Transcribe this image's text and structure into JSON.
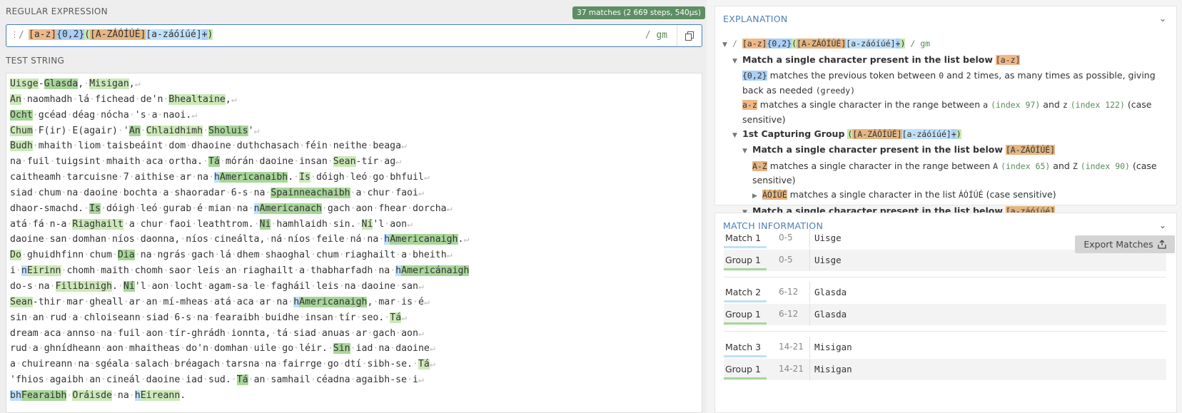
{
  "regex_section": {
    "title": "REGULAR EXPRESSION",
    "badge": "37 matches (2 669 steps, 540µs)",
    "delimiter": "/",
    "expression_parts": [
      "[a-z]",
      "{0,2}",
      "(",
      "[A-ZÁÓÍÚÉ]",
      "[a-záóíúé]",
      "+",
      ")"
    ],
    "flags_prefix": "/",
    "flags": "gm"
  },
  "test_section": {
    "title": "TEST STRING"
  },
  "explanation": {
    "title": "EXPLANATION",
    "root_regex_parts": [
      "[a-z]",
      "{0,2}",
      "(",
      "[A-ZÁÓÍÚÉ]",
      "[a-záóíúé]",
      "+",
      ")"
    ],
    "root_suffix": "/ gm",
    "item1_title": "Match a single character present in the list below",
    "item1_token": "[a-z]",
    "quant_token": "{0,2}",
    "quant_text_1": "matches the previous token between",
    "quant_n1": "0",
    "quant_text_2": "and",
    "quant_n2": "2",
    "quant_text_3": "times, as many times as possible, giving back as needed",
    "quant_greedy": "(greedy)",
    "range1_token": "a-z",
    "range1_text": "matches a single character in the range between",
    "range1_a": "a",
    "range1_a_idx": "(index 97)",
    "range1_and": "and",
    "range1_z": "z",
    "range1_z_idx": "(index 122)",
    "range1_tail": "(case sensitive)",
    "group_title": "1st Capturing Group",
    "group_parts": [
      "(",
      "[A-ZÁÓÍÚÉ]",
      "[a-záóíúé]",
      "+",
      ")"
    ],
    "item2_title": "Match a single character present in the list below",
    "item2_token": "[A-ZÁÓÍÚÉ]",
    "range2_token": "A-Z",
    "range2_text": "matches a single character in the range between",
    "range2_a": "A",
    "range2_a_idx": "(index 65)",
    "range2_and": "and",
    "range2_z": "Z",
    "range2_z_idx": "(index 90)",
    "range2_tail": "(case sensitive)",
    "list_token": "ÁÓÍÚÉ",
    "list_text": "matches a single character in the list",
    "list_chars": "ÁÓÍÚÉ",
    "list_tail": "(case sensitive)",
    "item3_title": "Match a single character present in the list below",
    "item3_token": "[a-záóíúé]"
  },
  "match_info": {
    "title": "MATCH INFORMATION",
    "export_label": "Export Matches",
    "rows": [
      {
        "label": "Match 1",
        "range": "0-5",
        "value": "Uisge",
        "kind": "match"
      },
      {
        "label": "Group 1",
        "range": "0-5",
        "value": "Uisge",
        "kind": "group"
      },
      {
        "label": "Match 2",
        "range": "6-12",
        "value": "Glasda",
        "kind": "match"
      },
      {
        "label": "Group 1",
        "range": "6-12",
        "value": "Glasda",
        "kind": "group"
      },
      {
        "label": "Match 3",
        "range": "14-21",
        "value": "Misigan",
        "kind": "match"
      },
      {
        "label": "Group 1",
        "range": "14-21",
        "value": "Misigan",
        "kind": "group"
      }
    ]
  },
  "colors": {
    "accent": "#4a7fb7",
    "badge": "#5e8e63",
    "match_light": "#cce9b8",
    "match_dark": "#a8d69a",
    "match_blue": "#bfe0f8"
  },
  "test_lines": [
    [
      {
        "t": "Uisge",
        "c": "m"
      },
      {
        "t": "-"
      },
      {
        "t": "Glasda",
        "c": "m2"
      },
      {
        "t": ",·"
      },
      {
        "t": "Misigan",
        "c": "m"
      },
      {
        "t": ",↵"
      }
    ],
    [
      {
        "t": "An",
        "c": "m"
      },
      {
        "t": "·naomhadh·lá·fichead·de'n·"
      },
      {
        "t": "Bhealtaine",
        "c": "m"
      },
      {
        "t": ",↵"
      }
    ],
    [
      {
        "t": "Ocht",
        "c": "m2"
      },
      {
        "t": "·gcéad·déag·nócha·'s·a·naoi.↵"
      }
    ],
    [
      {
        "t": "Chum",
        "c": "m"
      },
      {
        "t": "·F(ir)·E(agair)·'"
      },
      {
        "t": "An",
        "c": "m2"
      },
      {
        "t": "·"
      },
      {
        "t": "Chlaidhimh",
        "c": "m"
      },
      {
        "t": "·"
      },
      {
        "t": "Sholuis",
        "c": "m2"
      },
      {
        "t": "'↵"
      }
    ],
    [
      {
        "t": "Budh",
        "c": "m"
      },
      {
        "t": "·mhaith·liom·taisbeáint·dom·dhaoine·duthchasach·féin·neithe·beaga↵"
      }
    ],
    [
      {
        "t": "na·fuil·tuigsint·mhaith·aca·ortha.·"
      },
      {
        "t": "Tá",
        "c": "m2"
      },
      {
        "t": "·mórán·daoine·insan·"
      },
      {
        "t": "Sean",
        "c": "m"
      },
      {
        "t": "-tír·ag↵"
      }
    ],
    [
      {
        "t": "caitheamh·tarcuisne·7·aithise·ar·na·"
      },
      {
        "t": "h",
        "c": "mh"
      },
      {
        "t": "Americanaibh",
        "c": "m2"
      },
      {
        "t": ".·"
      },
      {
        "t": "Is",
        "c": "m"
      },
      {
        "t": "·dóigh·leó·go·bhfuil↵"
      }
    ],
    [
      {
        "t": "siad·chum·na·daoine·bochta·a·shaoradar·6-s·na·"
      },
      {
        "t": "Spainneachaibh",
        "c": "m2"
      },
      {
        "t": "·a·chur·faoi↵"
      }
    ],
    [
      {
        "t": "dhaor-smachd.·"
      },
      {
        "t": "Is",
        "c": "m2"
      },
      {
        "t": "·dóigh·leó·gurab·é·mian·na·"
      },
      {
        "t": "n",
        "c": "mh"
      },
      {
        "t": "Americanach",
        "c": "m2"
      },
      {
        "t": "·gach·aon·fhear·dorcha↵"
      }
    ],
    [
      {
        "t": "atá·fá·n-a·"
      },
      {
        "t": "Riaghailt",
        "c": "m"
      },
      {
        "t": "·a·chur·faoi·leathtrom.·"
      },
      {
        "t": "Ni",
        "c": "m2"
      },
      {
        "t": "·hamhlaidh·sin.·"
      },
      {
        "t": "Ní",
        "c": "m"
      },
      {
        "t": "'l·aon↵"
      }
    ],
    [
      {
        "t": "daoine·san·domhan·níos·daonna,·níos·cineálta,·ná·níos·feile·ná·na·"
      },
      {
        "t": "h",
        "c": "mh"
      },
      {
        "t": "Americanaigh",
        "c": "m2"
      },
      {
        "t": ".↵"
      }
    ],
    [
      {
        "t": "Do",
        "c": "m"
      },
      {
        "t": "·ghuidhfinn·chum·"
      },
      {
        "t": "Dia",
        "c": "m2"
      },
      {
        "t": "·na·ngrás·gach·lá·dhem·shaoghal·chum·riaghailt·a·bheith↵"
      }
    ],
    [
      {
        "t": "i·"
      },
      {
        "t": "n",
        "c": "mh"
      },
      {
        "t": "Eirinn",
        "c": "m"
      },
      {
        "t": "·chomh·maith·chomh·saor·leis·an·riaghailt·a·thabharfadh·na·"
      },
      {
        "t": "h",
        "c": "mh"
      },
      {
        "t": "Americánaigh",
        "c": "m2"
      },
      {
        "t": ""
      }
    ],
    [
      {
        "t": "do-s·na·"
      },
      {
        "t": "Filibinigh",
        "c": "m"
      },
      {
        "t": ".·"
      },
      {
        "t": "Ní",
        "c": "m2"
      },
      {
        "t": "'l·aon·locht·agam-sa·le·fagháil·leis·na·daoine·san↵"
      }
    ],
    [
      {
        "t": "Sean",
        "c": "m"
      },
      {
        "t": "-thir·mar·gheall·ar·an·mí-mheas·atá·aca·ar·na·"
      },
      {
        "t": "h",
        "c": "mh"
      },
      {
        "t": "Americanaigh",
        "c": "m2"
      },
      {
        "t": ",·mar·is·é↵"
      }
    ],
    [
      {
        "t": "sin·an·rud·a·chloiseann·siad·6-s·na·fearaibh·buidhe·insan·tír·seo.·"
      },
      {
        "t": "Tá",
        "c": "m"
      },
      {
        "t": "↵"
      }
    ],
    [
      {
        "t": "dream·aca·annso·na·fuil·aon·tír-ghrádh·ionnta,·tá·siad·anuas·ar·gach·aon↵"
      }
    ],
    [
      {
        "t": "rud·a·ghnídheann·aon·mhaitheas·do'n·domhan·uile·go·léir.·"
      },
      {
        "t": "Sin",
        "c": "m2"
      },
      {
        "t": "·iad·na·daoine↵"
      }
    ],
    [
      {
        "t": "a·chuireann·na·sgéala·salach·bréagach·tarsna·na·fairrge·go·dtí·sibh-se.·"
      },
      {
        "t": "Tá",
        "c": "m"
      },
      {
        "t": "↵"
      }
    ],
    [
      {
        "t": "'fhios·agaibh·an·cineál·daoine·iad·sud.·"
      },
      {
        "t": "Tá",
        "c": "m2"
      },
      {
        "t": "·an·samhail·céadna·agaibh-se·i↵"
      }
    ],
    [
      {
        "t": "bh",
        "c": "mh"
      },
      {
        "t": "Fearaibh",
        "c": "m2"
      },
      {
        "t": "·"
      },
      {
        "t": "Oráisde",
        "c": "m"
      },
      {
        "t": "·na·"
      },
      {
        "t": "h",
        "c": "mh"
      },
      {
        "t": "Eireann",
        "c": "m"
      },
      {
        "t": "."
      }
    ]
  ]
}
